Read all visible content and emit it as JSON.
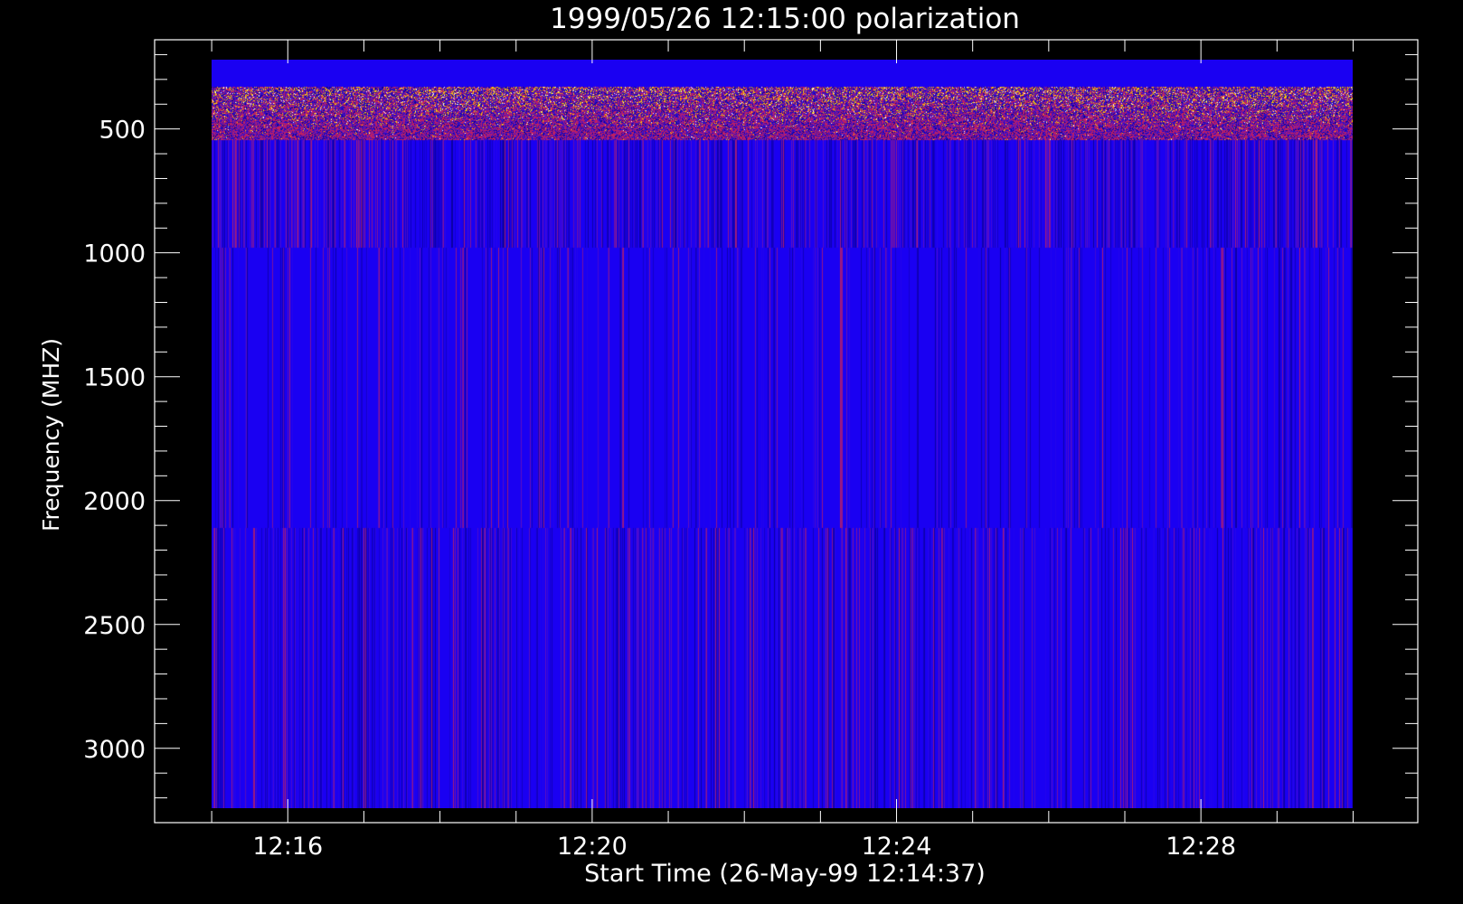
{
  "chart_data": {
    "type": "heatmap",
    "title": "1999/05/26 12:15:00 polarization",
    "xlabel": "Start Time (26-May-99 12:14:37)",
    "ylabel": "Frequency (MHZ)",
    "x_ticks": [
      {
        "label": "12:16",
        "minutes": 16
      },
      {
        "label": "12:20",
        "minutes": 20
      },
      {
        "label": "12:24",
        "minutes": 24
      },
      {
        "label": "12:28",
        "minutes": 28
      }
    ],
    "y_ticks": [
      500,
      1000,
      1500,
      2000,
      2500,
      3000
    ],
    "xlim_minutes_after_1200": [
      14.25,
      30.85
    ],
    "ylim": [
      3300,
      140
    ],
    "data_extent": {
      "x_minutes_after_1200": [
        15.0,
        30.0
      ],
      "y_mhz": [
        220,
        3240
      ]
    },
    "frequency_bands": [
      {
        "y_mhz": [
          220,
          330
        ],
        "pattern": "uniform"
      },
      {
        "y_mhz": [
          330,
          545
        ],
        "pattern": "noisy-speckle"
      },
      {
        "y_mhz": [
          545,
          980
        ],
        "pattern": "dark-striped"
      },
      {
        "y_mhz": [
          980,
          2110
        ],
        "pattern": "mild-striped"
      },
      {
        "y_mhz": [
          2110,
          3240
        ],
        "pattern": "striped"
      }
    ],
    "colors": {
      "background": "#000000",
      "axes": "#ffffff",
      "base": "#1a00f2",
      "dark": "#0a0096",
      "purple": "#6a12b8",
      "red": "#c02060",
      "yellow": "#ffd000",
      "white": "#ffffff"
    },
    "grid": false
  }
}
